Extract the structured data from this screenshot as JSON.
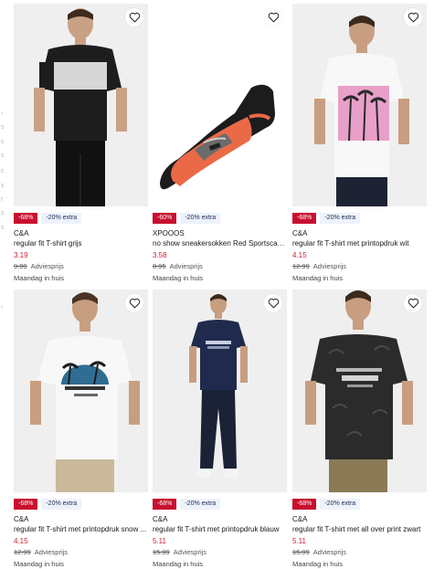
{
  "products": [
    {
      "brand": "C&A",
      "name": "regular fit T-shirt grijs",
      "price": "3.19",
      "original_price": "9.99",
      "original_label": "Adviesprijs",
      "discount": "-68%",
      "extra": "-20% extra",
      "delivery": "Maandag in huis",
      "image": "man in grey and black colour-block t-shirt",
      "favorite_icon": "heart-outline-icon"
    },
    {
      "brand": "XPOOOS",
      "name": "no show sneakersokken Red Sportscar z...",
      "price": "3.58",
      "original_price": "8.95",
      "original_label": "Adviesprijs",
      "discount": "-60%",
      "extra": "-20% extra",
      "delivery": "Maandag in huis",
      "image": "black no-show sock with red sportscar print",
      "favorite_icon": "heart-outline-icon"
    },
    {
      "brand": "C&A",
      "name": "regular fit T-shirt met printopdruk wit",
      "price": "4.15",
      "original_price": "12.99",
      "original_label": "Adviesprijs",
      "discount": "-68%",
      "extra": "-20% extra",
      "delivery": "Maandag in huis",
      "image": "man in white t-shirt with pink palm tree print",
      "favorite_icon": "heart-outline-icon"
    },
    {
      "brand": "C&A",
      "name": "regular fit T-shirt met printopdruk snow ...",
      "price": "4.15",
      "original_price": "12.99",
      "original_label": "Adviesprijs",
      "discount": "-68%",
      "extra": "-20% extra",
      "delivery": "Maandag in huis",
      "image": "man in white t-shirt with palm tree sunset print",
      "favorite_icon": "heart-outline-icon"
    },
    {
      "brand": "C&A",
      "name": "regular fit T-shirt met printopdruk blauw",
      "price": "5.11",
      "original_price": "15.99",
      "original_label": "Adviesprijs",
      "discount": "-68%",
      "extra": "-20% extra",
      "delivery": "Maandag in huis",
      "image": "man in navy t-shirt with print and dark jeans",
      "favorite_icon": "heart-outline-icon"
    },
    {
      "brand": "C&A",
      "name": "regular fit T-shirt met all over print zwart",
      "price": "5.11",
      "original_price": "15.99",
      "original_label": "Adviesprijs",
      "discount": "-68%",
      "extra": "-20% extra",
      "delivery": "Maandag in huis",
      "image": "man in black palm print t-shirt",
      "favorite_icon": "heart-outline-icon"
    }
  ],
  "colors": {
    "discount_badge": "#c8102e",
    "extra_badge_bg": "#eef2fb",
    "price": "#d0192e"
  }
}
